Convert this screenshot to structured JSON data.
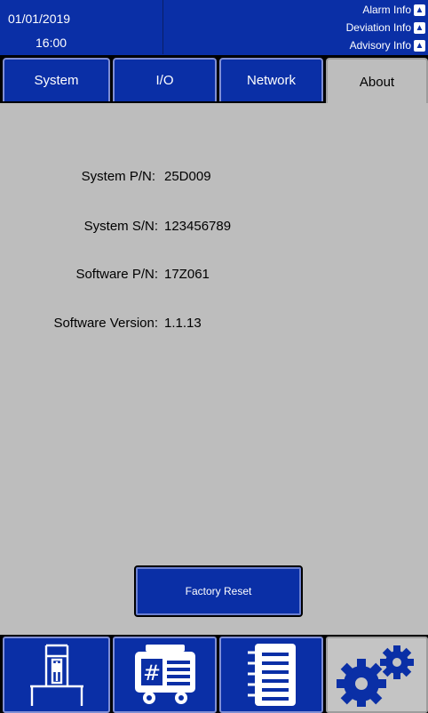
{
  "header": {
    "date": "01/01/2019",
    "time": "16:00",
    "info": [
      {
        "label": "Alarm Info",
        "icon": "bell-icon"
      },
      {
        "label": "Deviation Info",
        "icon": "bell-icon"
      },
      {
        "label": "Advisory Info",
        "icon": "bell-icon"
      }
    ]
  },
  "tabs": [
    {
      "label": "System",
      "active": false
    },
    {
      "label": "I/O",
      "active": false
    },
    {
      "label": "Network",
      "active": false
    },
    {
      "label": "About",
      "active": true
    }
  ],
  "about": {
    "rows": [
      {
        "label": "System P/N:",
        "value": "25D009"
      },
      {
        "label": "System S/N:",
        "value": "123456789"
      },
      {
        "label": "Software P/N:",
        "value": "17Z061"
      },
      {
        "label": "Software Version:",
        "value": "1.1.13"
      }
    ],
    "reset_label": "Factory Reset"
  },
  "nav": [
    {
      "icon": "fixture-icon",
      "active": false
    },
    {
      "icon": "sampler-icon",
      "active": false
    },
    {
      "icon": "notebook-icon",
      "active": false
    },
    {
      "icon": "gears-icon",
      "active": true
    }
  ],
  "colors": {
    "primary": "#0a2fa6",
    "panel": "#bdbdbd"
  }
}
